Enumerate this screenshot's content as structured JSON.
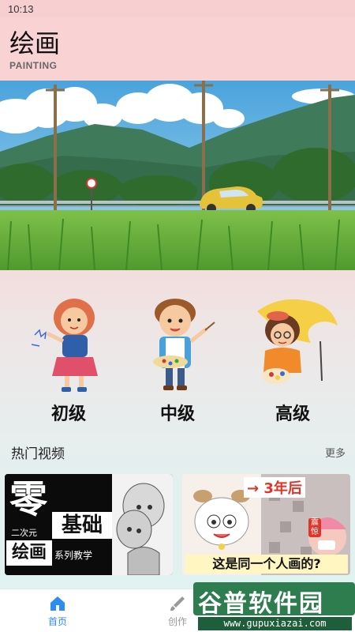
{
  "status": {
    "time": "10:13"
  },
  "header": {
    "title": "绘画",
    "subtitle": "PAINTING"
  },
  "levels": [
    {
      "label": "初级"
    },
    {
      "label": "中级"
    },
    {
      "label": "高级"
    }
  ],
  "hot_videos": {
    "title": "热门视频",
    "more": "更多",
    "videos": [
      {
        "big_char": "零",
        "line1": "基础",
        "tag": "二次元",
        "line2": "绘画",
        "suffix": "系列教学"
      },
      {
        "top_text": "→ 3年后",
        "side_text": "震惊",
        "caption": "这是同一个人画的?"
      }
    ]
  },
  "tabbar": {
    "tabs": [
      {
        "label": "首页",
        "active": true
      },
      {
        "label": "创作",
        "active": false
      }
    ],
    "active_color": "#2d8cf0"
  },
  "watermark": {
    "brand": "谷普软件园",
    "url": "www.gupuxiazai.com"
  }
}
